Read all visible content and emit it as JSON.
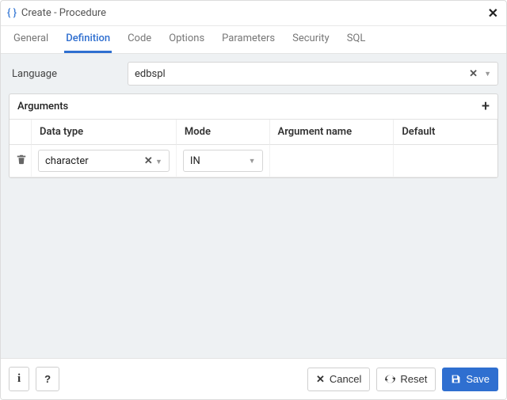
{
  "dialog": {
    "title": "Create - Procedure"
  },
  "tabs": [
    "General",
    "Definition",
    "Code",
    "Options",
    "Parameters",
    "Security",
    "SQL"
  ],
  "active_tab": "Definition",
  "lang": {
    "label": "Language",
    "value": "edbspl"
  },
  "args": {
    "title": "Arguments",
    "headers": {
      "data_type": "Data type",
      "mode": "Mode",
      "arg_name": "Argument name",
      "default": "Default"
    },
    "rows": [
      {
        "data_type": "character",
        "mode": "IN",
        "arg_name": "",
        "default": ""
      }
    ]
  },
  "footer": {
    "cancel": "Cancel",
    "reset": "Reset",
    "save": "Save"
  }
}
